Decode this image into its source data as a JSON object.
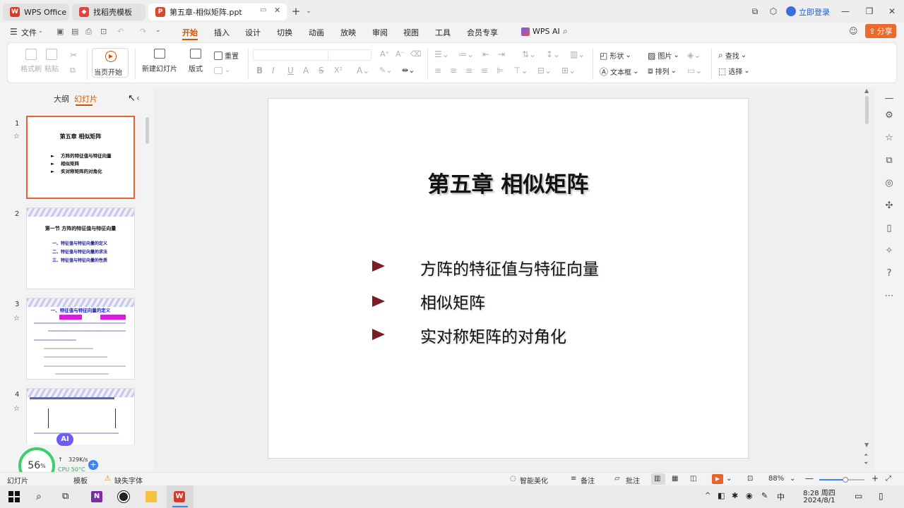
{
  "titlebar": {
    "tabs": [
      {
        "label": "WPS Office"
      },
      {
        "label": "找稻壳模板"
      },
      {
        "label": "第五章-相似矩阵.ppt"
      }
    ],
    "login": "立即登录"
  },
  "menubar": {
    "file": "文件",
    "items": [
      "开始",
      "插入",
      "设计",
      "切换",
      "动画",
      "放映",
      "审阅",
      "视图",
      "工具",
      "会员专享"
    ],
    "wps_ai": "WPS AI",
    "share": "分享"
  },
  "ribbon": {
    "format_painter": "格式刷",
    "paste": "粘贴",
    "start_from_current": "当页开始",
    "new_slide": "新建幻灯片",
    "layout": "版式",
    "reset": "重置",
    "shape": "形状",
    "picture": "图片",
    "textbox": "文本框",
    "arrange": "排列",
    "find": "查找",
    "select": "选择"
  },
  "leftpanel": {
    "tab_outline": "大纲",
    "tab_slides": "幻灯片",
    "thumbs": [
      {
        "num": "1",
        "title": "第五章 相似矩阵",
        "items": [
          "方阵的特征值与特征向量",
          "相似矩阵",
          "实对称矩阵的对角化"
        ]
      },
      {
        "num": "2",
        "title": "第一节 方阵的特征值与特征向量",
        "items": [
          "一、特征值与特征向量的定义",
          "二、特征值与特征向量的求法",
          "三、特征值与特征向量的性质"
        ]
      },
      {
        "num": "3",
        "title": "一、特征值与特征向量的定义"
      },
      {
        "num": "4"
      }
    ]
  },
  "slide": {
    "title": "第五章 相似矩阵",
    "bullets": [
      "方阵的特征值与特征向量",
      "相似矩阵",
      "实对称矩阵的对角化"
    ]
  },
  "widget": {
    "percent": "56",
    "speed": "329K/s",
    "cpu": "CPU 50°C",
    "ai": "AI"
  },
  "statusbar": {
    "slides": "幻灯片",
    "template": "模板",
    "missing_font": "缺失字体",
    "beautify": "智能美化",
    "notes": "备注",
    "comment": "批注",
    "zoom": "88%"
  },
  "taskbar": {
    "ime": "中",
    "time": "8:28 周四",
    "date": "2024/8/1"
  },
  "colors": {
    "accent": "#d35400",
    "share_bg": "#ec6a2c",
    "arrow": "#7a1d24"
  }
}
